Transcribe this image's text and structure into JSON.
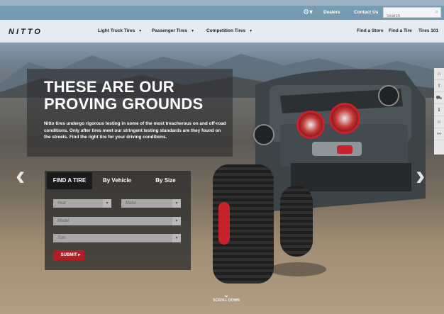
{
  "topbar": {
    "gear_icon": "gear-icon",
    "dealers_label": "Dealers",
    "contact_label": "Contact Us",
    "search_placeholder": "Search"
  },
  "nav": {
    "logo_text": "NITTO",
    "items": [
      {
        "label": "Light Truck Tires"
      },
      {
        "label": "Passenger Tires"
      },
      {
        "label": "Competition Tires"
      }
    ],
    "right_links": [
      "Find a Store",
      "Find a Tire",
      "Tires 101"
    ]
  },
  "hero": {
    "headline_1": "THESE ARE OUR",
    "headline_2": "PROVING GROUNDS",
    "body": "Nitto tires undergo rigorous testing in some of the most treacherous on and off-road conditions. Only after tires meet our stringent testing standards are they found on the streets. Find the right tire for your driving conditions."
  },
  "finder": {
    "tabs": [
      "FIND A TIRE",
      "By Vehicle",
      "By Size"
    ],
    "year_placeholder": "Year",
    "make_placeholder": "Make",
    "model_placeholder": "Model",
    "trim_placeholder": "Trim",
    "submit_label": "SUBMIT ▸"
  },
  "carousel": {
    "prev_glyph": "‹",
    "next_glyph": "›"
  },
  "scroll_hint": "SCROLL DOWN",
  "side_icons": [
    "home-icon",
    "share-icon",
    "car-icon",
    "info-icon",
    "people-icon",
    "link-icon"
  ],
  "colors": {
    "accent_red": "#b51b22",
    "topbar_blue": "#5a8ca5"
  }
}
